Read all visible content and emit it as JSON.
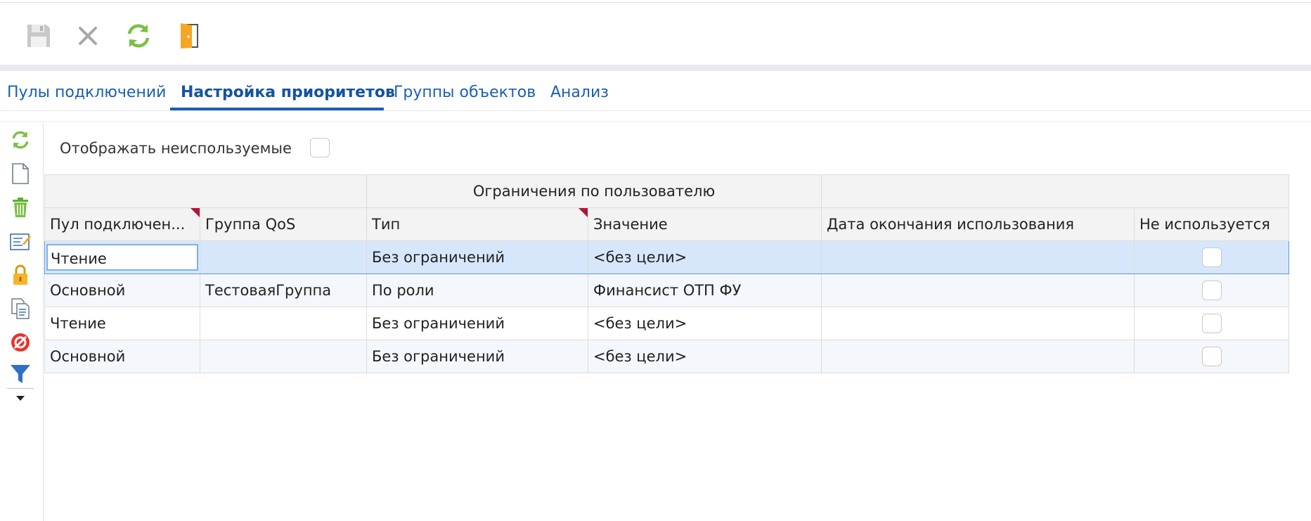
{
  "toolbar": {
    "buttons": [
      {
        "icon": "save-icon",
        "enabled": false
      },
      {
        "icon": "close-icon",
        "enabled": false
      },
      {
        "icon": "refresh-icon",
        "enabled": true
      },
      {
        "icon": "exit-door-icon",
        "enabled": true
      }
    ]
  },
  "tabs": [
    {
      "label": "Пулы подключений",
      "active": false
    },
    {
      "label": "Настройка приоритетов",
      "active": true
    },
    {
      "label": "Группы объектов",
      "active": false
    },
    {
      "label": "Анализ",
      "active": false
    }
  ],
  "sidebar": {
    "icons": [
      "refresh-icon",
      "new-document-icon",
      "trash-icon",
      "edit-icon",
      "lock-icon",
      "copy-icon",
      "disable-icon",
      "filter-icon",
      "dropdown-arrow-icon"
    ]
  },
  "filter": {
    "show_unused_label": "Отображать неиспользуемые",
    "show_unused_checked": false
  },
  "grid": {
    "group_header": "Ограничения по пользователю",
    "columns": {
      "pool": "Пул подключен...",
      "qos": "Группа QoS",
      "type": "Тип",
      "value": "Значение",
      "end_date": "Дата окончания использования",
      "unused": "Не используется"
    },
    "rows": [
      {
        "pool": "Чтение",
        "qos": "",
        "type": "Без ограничений",
        "value": "<без цели>",
        "end_date": "",
        "unused": false
      },
      {
        "pool": "Основной",
        "qos": "ТестоваяГруппа",
        "type": "По роли",
        "value": "Финансист ОТП ФУ",
        "end_date": "",
        "unused": false
      },
      {
        "pool": "Чтение",
        "qos": "",
        "type": "Без ограничений",
        "value": "<без цели>",
        "end_date": "",
        "unused": false
      },
      {
        "pool": "Основной",
        "qos": "",
        "type": "Без ограничений",
        "value": "<без цели>",
        "end_date": "",
        "unused": false
      }
    ]
  },
  "colors": {
    "accent": "#1a5fb4",
    "selected_row": "#d6e7fb",
    "alt_row": "#f4f7fb",
    "corner_marker": "#b3123a",
    "refresh_green": "#7bc043",
    "door_orange": "#f5a623"
  }
}
